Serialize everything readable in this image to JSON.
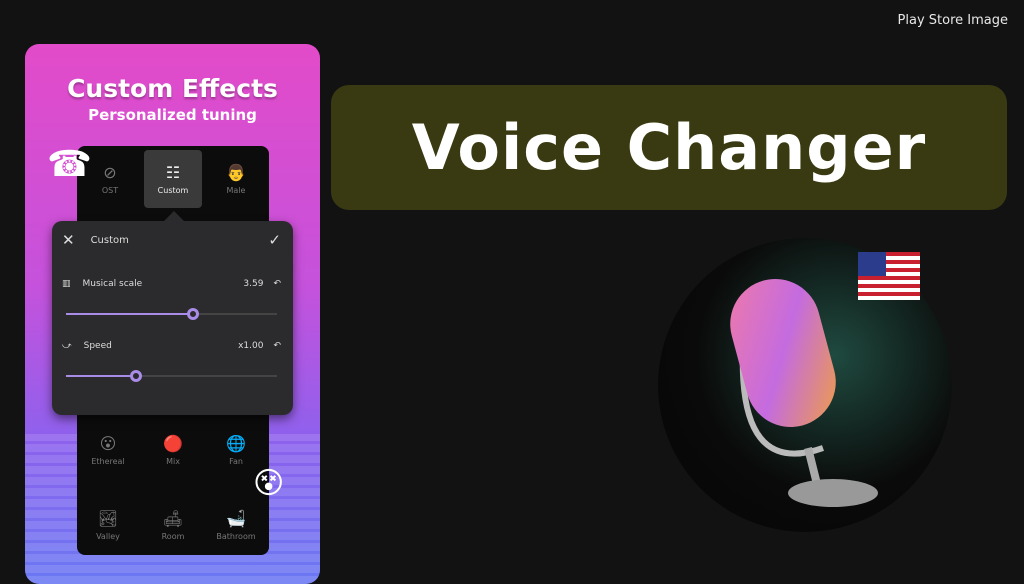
{
  "header": {
    "label": "Play Store Image"
  },
  "phone": {
    "title": "Custom Effects",
    "subtitle": "Personalized tuning",
    "top_effects": [
      {
        "label": "OST",
        "icon": "ban-icon"
      },
      {
        "label": "Custom",
        "icon": "sliders-icon",
        "selected": true
      },
      {
        "label": "Male",
        "icon": "male-face-icon"
      }
    ],
    "popup": {
      "title": "Custom",
      "musical_scale": {
        "label": "Musical scale",
        "value": "3.59",
        "level": 0.6
      },
      "speed": {
        "label": "Speed",
        "value": "x1.00",
        "level": 0.33
      }
    },
    "bottom_effects": [
      {
        "label": "Ethereal",
        "icon": "ethereal-icon"
      },
      {
        "label": "Mix",
        "icon": "mix-icon"
      },
      {
        "label": "Fan",
        "icon": "fan-icon"
      },
      {
        "label": "Valley",
        "icon": "valley-icon"
      },
      {
        "label": "Room",
        "icon": "room-icon"
      },
      {
        "label": "Bathroom",
        "icon": "bathtub-icon"
      }
    ]
  },
  "banner": {
    "title": "Voice Changer"
  },
  "colors": {
    "banner": "#3a3a12",
    "accent": "#a98ce8",
    "gradient_top": "#e24bc9",
    "gradient_bottom": "#6a78f2"
  }
}
